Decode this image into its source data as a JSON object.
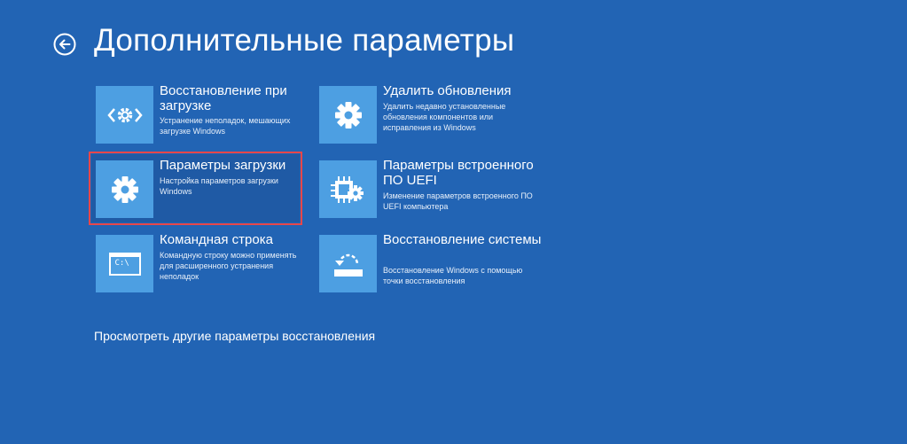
{
  "header": {
    "title": "Дополнительные параметры",
    "back_icon": "back-arrow-icon"
  },
  "tiles": [
    {
      "title": "Восстановление при загрузке",
      "description": "Устранение неполадок, мешающих загрузке Windows",
      "icon": "startup-repair-icon"
    },
    {
      "title": "Удалить обновления",
      "description": "Удалить недавно установленные обновления компонентов или исправления из Windows",
      "icon": "gear-icon"
    },
    {
      "title": "Параметры загрузки",
      "description": "Настройка параметров загрузки Windows",
      "icon": "gear-icon",
      "selected": true
    },
    {
      "title": "Параметры встроенного ПО UEFI",
      "description": "Изменение параметров встроенного ПО UEFI компьютера",
      "icon": "chip-gear-icon"
    },
    {
      "title": "Командная строка",
      "description": "Командную строку можно применять для расширенного устранения неполадок",
      "icon": "command-prompt-icon",
      "icon_text": "C:\\"
    },
    {
      "title": "Восстановление системы",
      "description": "Восстановление Windows с помощью точки восстановления",
      "icon": "system-restore-icon"
    }
  ],
  "more_link": "Просмотреть другие параметры восстановления",
  "colors": {
    "background": "#2264b4",
    "tile_icon_bg": "#4d9fe2",
    "selection_border": "#e8474a"
  }
}
